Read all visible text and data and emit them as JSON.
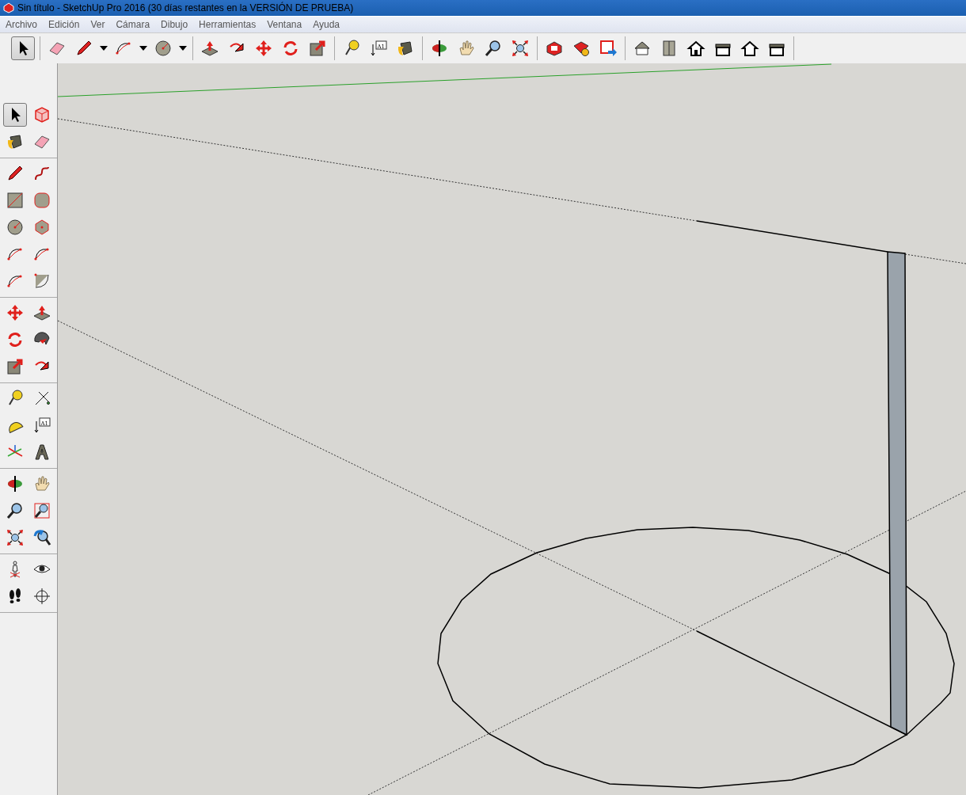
{
  "window": {
    "title": "Sin título - SketchUp Pro 2016 (30 días restantes en la VERSIÓN DE PRUEBA)"
  },
  "menu": [
    "Archivo",
    "Edición",
    "Ver",
    "Cámara",
    "Dibujo",
    "Herramientas",
    "Ventana",
    "Ayuda"
  ],
  "top_toolbar": [
    [
      {
        "kind": "arrow",
        "selected": true,
        "dropdown": false
      }
    ],
    [
      {
        "kind": "eraser",
        "selected": false,
        "dropdown": false
      },
      {
        "kind": "pencil",
        "selected": false,
        "dropdown": true
      },
      {
        "kind": "arc",
        "selected": false,
        "dropdown": true
      },
      {
        "kind": "circle",
        "selected": false,
        "dropdown": true
      }
    ],
    [
      {
        "kind": "pushpull",
        "selected": false,
        "dropdown": false
      },
      {
        "kind": "curved-arrow",
        "selected": false,
        "dropdown": false
      },
      {
        "kind": "move",
        "selected": false,
        "dropdown": false
      },
      {
        "kind": "rotate",
        "selected": false,
        "dropdown": false
      },
      {
        "kind": "scale",
        "selected": false,
        "dropdown": false
      }
    ],
    [
      {
        "kind": "tape",
        "selected": false,
        "dropdown": false
      },
      {
        "kind": "text",
        "label": "A1",
        "selected": false,
        "dropdown": false
      },
      {
        "kind": "bucket",
        "selected": false,
        "dropdown": false
      }
    ],
    [
      {
        "kind": "orbit",
        "selected": false,
        "dropdown": false
      },
      {
        "kind": "hand",
        "selected": false,
        "dropdown": false
      },
      {
        "kind": "magnifier",
        "selected": false,
        "dropdown": false
      },
      {
        "kind": "zoom-extents",
        "selected": false,
        "dropdown": false
      }
    ],
    [
      {
        "kind": "box",
        "selected": false,
        "dropdown": false
      },
      {
        "kind": "gem",
        "selected": false,
        "dropdown": false
      },
      {
        "kind": "share",
        "selected": false,
        "dropdown": false
      }
    ],
    [
      {
        "kind": "house",
        "selected": false,
        "dropdown": false
      },
      {
        "kind": "door",
        "selected": false,
        "dropdown": false
      },
      {
        "kind": "house-front",
        "selected": false,
        "dropdown": false
      },
      {
        "kind": "house-side",
        "selected": false,
        "dropdown": false
      },
      {
        "kind": "house-outline",
        "selected": false,
        "dropdown": false
      },
      {
        "kind": "house-side",
        "selected": false,
        "dropdown": false
      }
    ]
  ],
  "left_toolbar": [
    [
      {
        "kind": "arrow",
        "selected": true
      },
      {
        "kind": "cube",
        "selected": false
      },
      {
        "kind": "bucket",
        "selected": false
      },
      {
        "kind": "eraser",
        "selected": false
      }
    ],
    [
      {
        "kind": "pencil",
        "selected": false
      },
      {
        "kind": "squiggle",
        "selected": false
      },
      {
        "kind": "rectangle",
        "selected": false
      },
      {
        "kind": "rounded-rectangle",
        "selected": false
      },
      {
        "kind": "circle",
        "selected": false
      },
      {
        "kind": "polygon",
        "selected": false
      },
      {
        "kind": "arc",
        "selected": false
      },
      {
        "kind": "arc",
        "selected": false
      },
      {
        "kind": "arc",
        "selected": false
      },
      {
        "kind": "pie",
        "selected": false
      }
    ],
    [
      {
        "kind": "move",
        "selected": false
      },
      {
        "kind": "pushpull",
        "selected": false
      },
      {
        "kind": "rotate",
        "selected": false
      },
      {
        "kind": "swirl",
        "selected": false
      },
      {
        "kind": "scale",
        "selected": false
      },
      {
        "kind": "curved-arrow",
        "selected": false
      }
    ],
    [
      {
        "kind": "tape",
        "selected": false
      },
      {
        "kind": "dimension",
        "selected": false
      },
      {
        "kind": "protractor",
        "selected": false
      },
      {
        "kind": "text",
        "label": "A1",
        "selected": false
      },
      {
        "kind": "axes",
        "selected": false
      },
      {
        "kind": "letter-a",
        "selected": false
      }
    ],
    [
      {
        "kind": "orbit",
        "selected": false
      },
      {
        "kind": "hand",
        "selected": false
      },
      {
        "kind": "magnifier",
        "selected": false
      },
      {
        "kind": "zoom-window",
        "selected": false
      },
      {
        "kind": "zoom-extents",
        "selected": false
      },
      {
        "kind": "magnifier-back",
        "selected": false
      }
    ],
    [
      {
        "kind": "person",
        "selected": false
      },
      {
        "kind": "eye",
        "selected": false
      },
      {
        "kind": "footprints",
        "selected": false
      },
      {
        "kind": "crosshair",
        "selected": false
      }
    ]
  ]
}
